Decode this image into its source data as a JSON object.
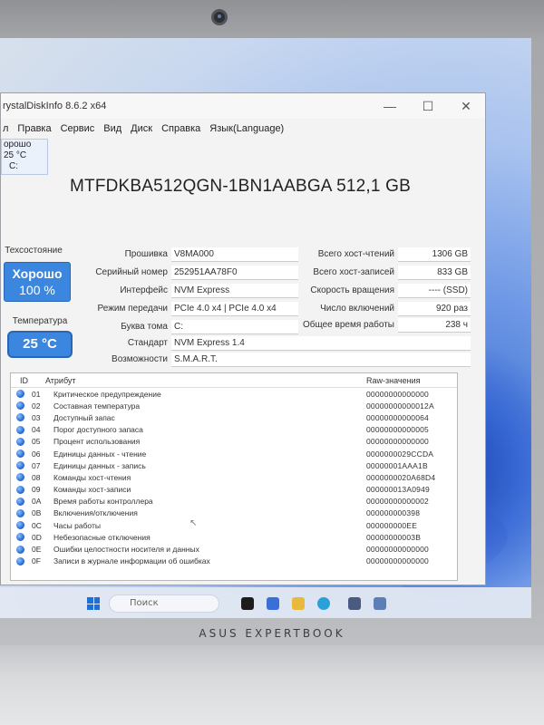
{
  "window": {
    "title": "rystalDiskInfo 8.6.2 x64"
  },
  "menu": [
    "л",
    "Правка",
    "Сервис",
    "Вид",
    "Диск",
    "Справка",
    "Язык(Language)"
  ],
  "drive_tab": {
    "status": "орошо",
    "temp": "25 °C",
    "letter": "C:"
  },
  "model": "MTFDKBA512QGN-1BN1AABGA 512,1 GB",
  "health": {
    "label": "Техсостояние",
    "status": "Хорошо",
    "percent": "100 %"
  },
  "temperature": {
    "label": "Температура",
    "value": "25 °C"
  },
  "info_left": {
    "firmware": {
      "label": "Прошивка",
      "value": "V8MA000"
    },
    "serial": {
      "label": "Серийный номер",
      "value": "252951AA78F0"
    },
    "interface": {
      "label": "Интерфейс",
      "value": "NVM Express"
    },
    "transfer": {
      "label": "Режим передачи",
      "value": "PCIe 4.0 x4 | PCIe 4.0 x4"
    },
    "volume": {
      "label": "Буква тома",
      "value": "C:"
    },
    "standard": {
      "label": "Стандарт",
      "value": "NVM Express 1.4"
    },
    "features": {
      "label": "Возможности",
      "value": "S.M.A.R.T."
    }
  },
  "info_right": {
    "host_reads": {
      "label": "Всего хост-чтений",
      "value": "1306 GB"
    },
    "host_writes": {
      "label": "Всего хост-записей",
      "value": "833 GB"
    },
    "rotation": {
      "label": "Скорость вращения",
      "value": "---- (SSD)"
    },
    "power_count": {
      "label": "Число включений",
      "value": "920 раз"
    },
    "power_hours": {
      "label": "Общее время работы",
      "value": "238 ч"
    }
  },
  "smart": {
    "headers": {
      "id": "ID",
      "attribute": "Атрибут",
      "raw": "Raw-значения"
    },
    "rows": [
      {
        "id": "01",
        "name": "Критическое предупреждение",
        "raw": "00000000000000"
      },
      {
        "id": "02",
        "name": "Составная температура",
        "raw": "00000000000012A"
      },
      {
        "id": "03",
        "name": "Доступный запас",
        "raw": "00000000000064"
      },
      {
        "id": "04",
        "name": "Порог доступного запаса",
        "raw": "00000000000005"
      },
      {
        "id": "05",
        "name": "Процент использования",
        "raw": "00000000000000"
      },
      {
        "id": "06",
        "name": "Единицы данных - чтение",
        "raw": "0000000029CCDA"
      },
      {
        "id": "07",
        "name": "Единицы данных - запись",
        "raw": "00000001AAA1B"
      },
      {
        "id": "08",
        "name": "Команды хост-чтения",
        "raw": "0000000020A68D4"
      },
      {
        "id": "09",
        "name": "Команды хост-записи",
        "raw": "000000013A0949"
      },
      {
        "id": "0A",
        "name": "Время работы контроллера",
        "raw": "00000000000002"
      },
      {
        "id": "0B",
        "name": "Включения/отключения",
        "raw": "000000000398"
      },
      {
        "id": "0C",
        "name": "Часы работы",
        "raw": "000000000EE"
      },
      {
        "id": "0D",
        "name": "Небезопасные отключения",
        "raw": "00000000003B"
      },
      {
        "id": "0E",
        "name": "Ошибки целостности носителя и данных",
        "raw": "00000000000000"
      },
      {
        "id": "0F",
        "name": "Записи в журнале информации об ошибках",
        "raw": "00000000000000"
      }
    ]
  },
  "taskbar": {
    "search_placeholder": "Поиск"
  },
  "brand": "ASUS EXPERTBOOK"
}
